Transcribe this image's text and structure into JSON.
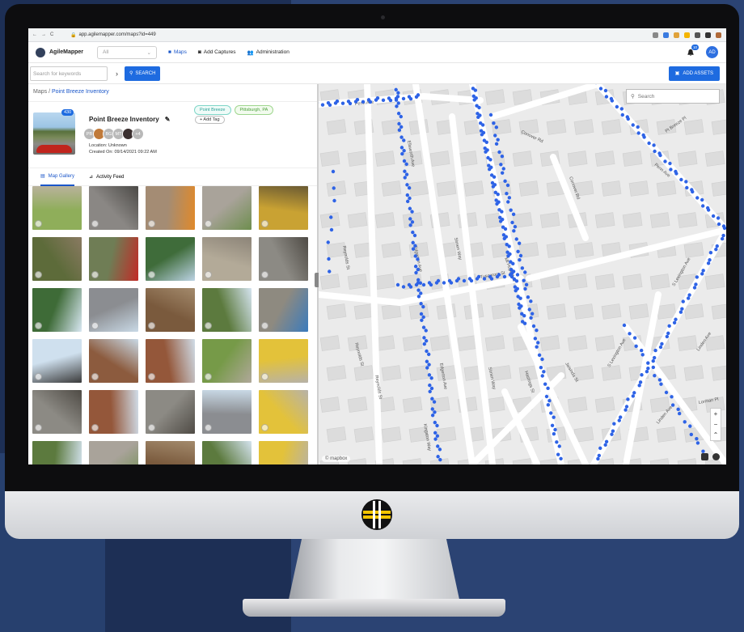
{
  "browser": {
    "url": "app.agilemapper.com/maps?id=449",
    "nav": [
      "←",
      "→",
      "C"
    ],
    "ext_colors": [
      "#888888",
      "#3a7be0",
      "#e0a23a",
      "#f4b400",
      "#555555",
      "#333333",
      "#b06a3a"
    ]
  },
  "header": {
    "brand": "AgileMapper",
    "filter_value": "All",
    "nav": [
      {
        "label": "Maps",
        "icon": "folder-icon",
        "active": true
      },
      {
        "label": "Add Captures",
        "icon": "camera-icon",
        "active": false
      },
      {
        "label": "Administration",
        "icon": "users-icon",
        "active": false
      }
    ],
    "notifications": "10",
    "user_initials": "AD"
  },
  "search": {
    "placeholder": "Search for keywords",
    "chevron": "›",
    "button": "SEARCH",
    "add_assets": "ADD ASSETS"
  },
  "breadcrumb": {
    "root": "Maps",
    "sep": "/",
    "current": "Point Breeze Inventory"
  },
  "map_card": {
    "title": "Point Breeze Inventory",
    "count": "430",
    "contributors": [
      {
        "initials": "PB",
        "color": "#b9b9b9"
      },
      {
        "initials": "",
        "color": "#c07a3a"
      },
      {
        "initials": "BG",
        "color": "#b9b9b9"
      },
      {
        "initials": "MT",
        "color": "#b9b9b9"
      },
      {
        "initials": "",
        "color": "#3b3030"
      },
      {
        "initials": "+4",
        "color": "#b9b9b9"
      }
    ],
    "location": "Location: Unknown",
    "created": "Created On: 09/14/2021 09:22 AM",
    "tags": [
      "Point Breeze",
      "Pittsburgh, PA"
    ],
    "add_tag": "+ Add Tag"
  },
  "tabs": [
    {
      "label": "Map Gallery",
      "icon": "image-icon",
      "active": true
    },
    {
      "label": "Activity Feed",
      "icon": "rss-icon",
      "active": false
    }
  ],
  "gallery": [
    "grass-sidewalk",
    "hydrant-cap-metal",
    "orange-drip-paint",
    "sidewalk-curb",
    "gas-cap-yellow",
    "tree-trunk",
    "red-hydrant",
    "tree-canopy",
    "concrete-slab",
    "manhole-cover",
    "green-trees",
    "stop-sign-street",
    "rusty-grate",
    "utility-pole",
    "blue-valve",
    "street-light",
    "houses",
    "brick-houses",
    "curb-grass",
    "yellow-tactile",
    "manhole-rusty",
    "church",
    "manhole-asphalt",
    "stop-sign-street-2",
    "yellow-tactile-2",
    "power-pole",
    "sidewalk",
    "grate-cover",
    "utility-pole-2",
    "yellow-tactile-3"
  ],
  "map": {
    "search_placeholder": "Search",
    "attribution": "© mapbox",
    "zoom_in": "+",
    "zoom_out": "−",
    "compass": "⌃",
    "streets": [
      "Penn Ave",
      "Ellsworth Ave",
      "Conover Rd",
      "Pt Breeze Pl",
      "Penn Ave",
      "Conover Rd",
      "Reynolds St",
      "Reynolds St",
      "Edgerton Ave",
      "Edgerton Ave",
      "Simen Way",
      "Tuscarora St",
      "Mt Hope Ave",
      "S Lexington Ave",
      "S Lexington Ave",
      "Reynolds St",
      "Kingston Way",
      "Simen Way",
      "Hastings St",
      "Jaisinda St",
      "Linden Ave",
      "Linden Ave",
      "Lorman Pl"
    ]
  }
}
